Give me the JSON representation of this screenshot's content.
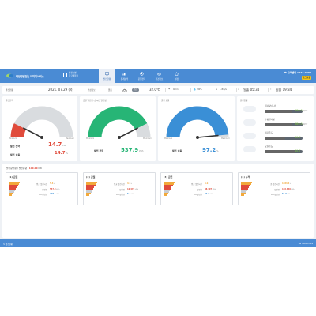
{
  "header": {
    "logo_text": "태양광발전 | 이미지서비스",
    "plant_line1": "발전소명",
    "plant_line2": "한국태양광",
    "nav": [
      {
        "label": "발전현황",
        "icon": "monitor-icon",
        "active": true
      },
      {
        "label": "통계분석",
        "icon": "chart-icon",
        "active": false
      },
      {
        "label": "운영관리",
        "icon": "gear-icon",
        "active": false
      },
      {
        "label": "환경정보",
        "icon": "cloud-icon",
        "active": false
      },
      {
        "label": "설정",
        "icon": "home-icon",
        "active": false
      }
    ],
    "phone": "☎ 고객센터 1522-0000",
    "login_button": "로그아웃"
  },
  "infobar": {
    "section": "발전현황",
    "date": "2021. 07.29 (목)",
    "weather_label": "기상정보",
    "weather_state": "맑음",
    "weather_badge": "기온",
    "temperature": "32.0℃",
    "rain": "0mm",
    "humidity": "30%",
    "wind": "1.8m/s",
    "sunrise": "일출 05:34",
    "sunset": "일몰 19:34"
  },
  "cards": {
    "power": {
      "title": "발전전력",
      "min": "Minimum",
      "max": "Maximum",
      "label1": "발전 전력",
      "value1": "14.7",
      "unit1": "kW",
      "label2": "발전 효율",
      "value2": "14.7",
      "unit2": "%",
      "level": 0.15,
      "color": "#e04b3b"
    },
    "today": {
      "title": "금일 발전량 (실시간 발전량)",
      "min": "Minimum",
      "max": "Maximum",
      "label1": "발전 전력",
      "value1": "537.9",
      "unit1": "kWh",
      "level": 0.85,
      "color": "#27b576"
    },
    "rate": {
      "title": "발전 효율",
      "min": "Minimum",
      "max": "Maximum",
      "label1": "발전 효율",
      "value1": "97.2",
      "unit1": "%",
      "level": 0.97,
      "color": "#3a8fd6"
    },
    "status": {
      "title": "운전현황",
      "items": [
        {
          "label": "일사량(경사)",
          "value": "380.0",
          "unit": "W/m²",
          "level": 0.72
        },
        {
          "label": "수평일사량",
          "value": "380.0",
          "unit": "W/m²",
          "level": 0.72
        },
        {
          "label": "외기온도",
          "value": "30.7",
          "unit": "℃",
          "level": 0.55
        },
        {
          "label": "모듈온도",
          "value": "40.7",
          "unit": "℃",
          "level": 0.82
        }
      ]
    }
  },
  "bottom": {
    "title": "발전량현황",
    "capacity_label": "( 발전용량 :",
    "capacity_value": "100.00",
    "capacity_unit": "kW )",
    "panels": [
      {
        "title": "(1) 금일",
        "r1_label": "평균 발전시간",
        "r1_value": "5.4",
        "r1_unit": "h",
        "r2_label": "발전량",
        "r2_value": "537.9",
        "r2_unit": "kWh",
        "r3_label": "CO₂절감량",
        "r3_value": "228.1",
        "r3_unit": "tCO₂"
      },
      {
        "title": "(2) 금월",
        "r1_label": "평균 발전시간",
        "r1_value": "4.5",
        "r1_unit": "h",
        "r2_label": "발전량",
        "r2_value": "12,472",
        "r2_unit": "kWh",
        "r3_label": "CO₂절감량",
        "r3_value": "5.3",
        "r3_unit": "tCO₂"
      },
      {
        "title": "(3) 금년",
        "r1_label": "평균 발전시간",
        "r1_value": "4.2",
        "r1_unit": "h",
        "r2_label": "발전량",
        "r2_value": "88,397",
        "r2_unit": "kWh",
        "r3_label": "CO₂절감량",
        "r3_value": "37.4",
        "r3_unit": "tCO₂"
      },
      {
        "title": "(4) 누적",
        "r1_label": "총 발전시간",
        "r1_value": "1284.4",
        "r1_unit": "h",
        "r2_label": "발전량",
        "r2_value": "126,640",
        "r2_unit": "kWh",
        "r3_label": "CO₂절감량",
        "r3_value": "53.6",
        "r3_unit": "tCO₂"
      }
    ]
  },
  "footer": {
    "left": "© 발전현황",
    "right": "ver 2021.07.29"
  },
  "colors": {
    "header": "#4a8bd4",
    "red": "#e04b3b",
    "green": "#27b576",
    "blue": "#3a8fd6",
    "lime": "#7bc142"
  }
}
